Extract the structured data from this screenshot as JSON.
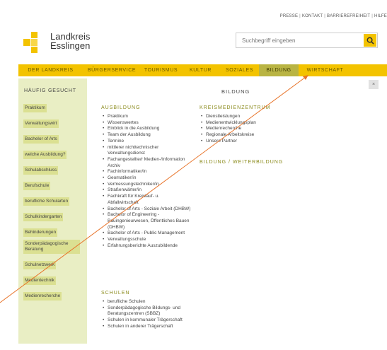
{
  "topbar": {
    "presse": "PRESSE",
    "kontakt": "KONTAKT",
    "barrierefreiheit": "BARRIEREFREIHEIT",
    "hilfe": "HILFE",
    "separator": "|"
  },
  "logo": {
    "line1": "Landkreis",
    "line2": "Esslingen"
  },
  "search": {
    "placeholder": "Suchbegriff eingeben"
  },
  "nav": {
    "items": [
      "DER LANDKREIS",
      "BÜRGERSERVICE",
      "TOURISMUS",
      "KULTUR",
      "SOZIALES",
      "BILDUNG",
      "WIRTSCHAFT"
    ],
    "active": "BILDUNG"
  },
  "sidebar": {
    "title": "HÄUFIG GESUCHT",
    "items": [
      "Praktikum",
      "Verwaltungswirt",
      "Bachelor of Arts",
      "welche Ausbildung?",
      "Schulabschluss",
      "Berufschule",
      "berufliche Schularten",
      "Schulkindergarten",
      "Behinderungen",
      "Sonderpädagogische Beratung",
      "Schulnetzwerk",
      "Medientechnik",
      "Medienrecherche"
    ]
  },
  "main": {
    "title": "BILDUNG",
    "close": "×",
    "ausbildung": {
      "title": "AUSBILDUNG",
      "items": [
        "Praktikum",
        "Wissenswertes",
        "Einblick in die Ausbildung",
        "Team der Ausbildung",
        "Termine",
        "mittlerer nichttechnischer Verwaltungsdienst",
        "Fachangestellte/r Medien-/Information Archiv",
        "Fachinformatiker/in",
        "Geomatiker/in",
        "Vermessungstechniker/in",
        "Straßenwärter/in",
        "Fachkraft für Kreislauf- u. Abfallwirtschaft",
        "Bachelor of Arts - Soziale Arbeit (DHBW)",
        "Bachelor of Engineering - Bauingenieurwesen, Öffentliches Bauen (DHBW)",
        "Bachelor of Arts - Public Management",
        "Verwaltungsschule",
        "Erfahrungsberichte Auszubildende"
      ]
    },
    "schulen": {
      "title": "SCHULEN",
      "items": [
        "berufliche Schulen",
        "Sonderpädagogische Bildungs- und Beratungszentren (SBBZ)",
        "Schulen in kommunaler Trägerschaft",
        "Schulen in anderer Trägerschaft"
      ]
    },
    "kreismedienzentrum": {
      "title": "KREISMEDIENZENTRUM",
      "items": [
        "Dienstleistungen",
        "Medienentwicklungsplan",
        "Medienrecherche",
        "Regionale Arbeitskreise",
        "Unsere Partner"
      ]
    },
    "weiterbildung": {
      "title": "BILDUNG / WEITERBILDUNG"
    }
  },
  "colors": {
    "brand_yellow": "#f3c300",
    "nav_active": "#b9b443",
    "sidebar_bg": "#e9eec4",
    "sidebar_item_bg": "#dbe092",
    "section_title": "#8a8a1a",
    "pointer_line": "#e8742a"
  },
  "icons": {
    "search": "search-icon",
    "close": "close-icon",
    "bullet": "bullet-icon"
  }
}
